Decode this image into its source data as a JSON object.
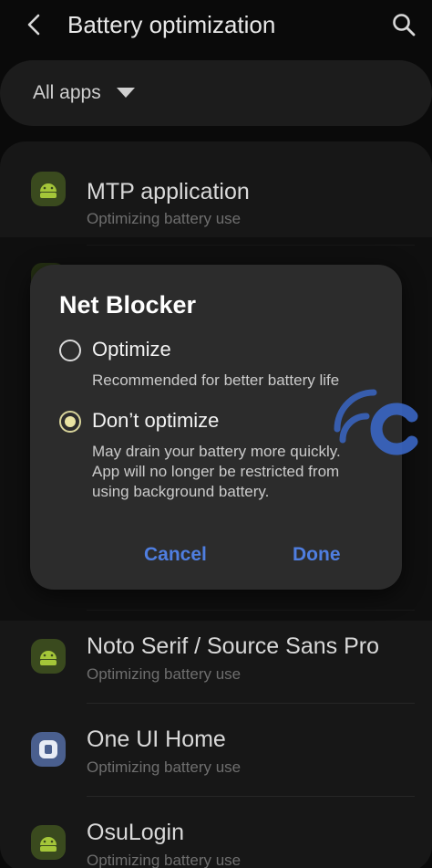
{
  "header": {
    "title": "Battery optimization",
    "back_icon": "chevron-left-icon",
    "search_icon": "search-icon"
  },
  "filter": {
    "label": "All apps",
    "caret_icon": "caret-down-icon"
  },
  "apps": [
    {
      "name": "MTP application",
      "status": "Optimizing battery use",
      "icon": "android-icon"
    },
    {
      "name": "Noto Serif / Source Sans Pro",
      "status": "Optimizing battery use",
      "icon": "android-icon"
    },
    {
      "name": "One UI Home",
      "status": "Optimizing battery use",
      "icon": "oneui-home-icon"
    },
    {
      "name": "OsuLogin",
      "status": "Optimizing battery use",
      "icon": "android-icon"
    }
  ],
  "dialog": {
    "title": "Net Blocker",
    "options": [
      {
        "label": "Optimize",
        "desc_lines": [
          "Recommended for better battery life"
        ],
        "selected": false
      },
      {
        "label": "Don’t optimize",
        "desc_lines": [
          "May drain your battery more quickly.",
          "App will no longer be restricted from",
          "using background battery."
        ],
        "selected": true
      }
    ],
    "cancel_label": "Cancel",
    "done_label": "Done"
  },
  "colors": {
    "accent": "#4f7ee0",
    "radio_selected": "#e9e3a2",
    "background": "#0a0a0a",
    "dialog_bg": "#2c2c2c"
  }
}
